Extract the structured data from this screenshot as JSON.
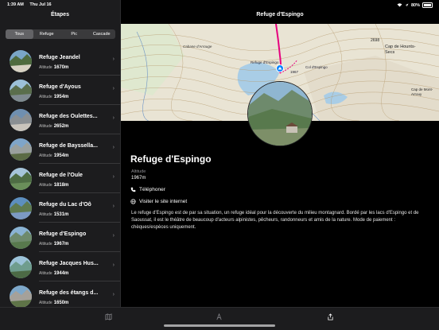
{
  "status": {
    "time": "1:39 AM",
    "date": "Thu Jul 16",
    "battery": "80%"
  },
  "sidebar": {
    "title": "Étapes",
    "segments": [
      "Tous",
      "Refuge",
      "Pic",
      "Cascade"
    ],
    "items": [
      {
        "name": "Refuge Jeandel",
        "alt_label": "Altitude",
        "alt": "1670m"
      },
      {
        "name": "Refuge d'Ayous",
        "alt_label": "Altitude",
        "alt": "1954m"
      },
      {
        "name": "Refuge des Oulettes...",
        "alt_label": "Altitude",
        "alt": "2652m"
      },
      {
        "name": "Refuge de Bayssella...",
        "alt_label": "Altitude",
        "alt": "1954m"
      },
      {
        "name": "Refuge de l'Oule",
        "alt_label": "Altitude",
        "alt": "1818m"
      },
      {
        "name": "Refuge du Lac d'Oô",
        "alt_label": "Altitude",
        "alt": "1531m"
      },
      {
        "name": "Refuge d'Espingo",
        "alt_label": "Altitude",
        "alt": "1967m"
      },
      {
        "name": "Refuge Jacques Hus...",
        "alt_label": "Altitude",
        "alt": "1944m"
      },
      {
        "name": "Refuge des étangs d...",
        "alt_label": "Altitude",
        "alt": "1650m"
      }
    ]
  },
  "detail": {
    "nav_title": "Refuge d'Espingo",
    "name": "Refuge d'Espingo",
    "alt_label": "Altitude",
    "alt_value": "1967m",
    "phone_label": "Téléphoner",
    "website_label": "Visiter le site internet",
    "description": "Le refuge d'Espingo est de par sa situation, un refuge idéal pour la découverte du milieu montagnard. Bordé par les lacs d'Espingo et de Saoussat, il est le théâtre de beaucoup d'acteurs alpinistes, pêcheurs, randonneurs et amis de la nature. Mode de paiement : chèques/espèces uniquement.",
    "map_labels": {
      "cabane": "Cabane d'Arrouge",
      "refuge": "Refuge d'Espingo",
      "refuge_alt": "1967",
      "col": "Col d'Espingo",
      "peak1_alt": "2698",
      "peak1_name": "Cap de Hounts-Secs",
      "peak2_name": "Cap de Mont-Arrouy"
    }
  },
  "colors": {
    "accent": "#0a84ff",
    "route": "#e6007e"
  }
}
